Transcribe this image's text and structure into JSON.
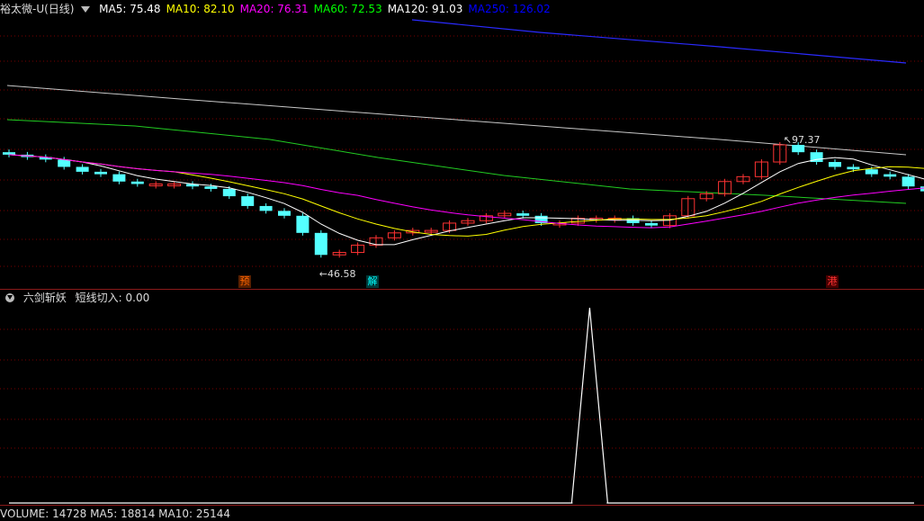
{
  "main_panel": {
    "stock_name": "裕太微-U(日线)",
    "indicators": [
      {
        "label": "MA5: 75.48",
        "color": "#ffffff"
      },
      {
        "label": "MA10: 82.10",
        "color": "#ffff00"
      },
      {
        "label": "MA20: 76.31",
        "color": "#ff00ff"
      },
      {
        "label": "MA60: 72.53",
        "color": "#00ff00"
      },
      {
        "label": "MA120: 91.03",
        "color": "#ffffff"
      },
      {
        "label": "MA250: 126.02",
        "color": "#0000ff"
      }
    ],
    "high_label": "97.37",
    "low_label": "46.58",
    "tags": [
      {
        "text": "预",
        "color": "#ff6600",
        "bg": "#5a2000"
      },
      {
        "text": "解",
        "color": "#00ffff",
        "bg": "#003a3a"
      },
      {
        "text": "港",
        "color": "#ff3333",
        "bg": "#4a0000"
      }
    ]
  },
  "sub_panel": {
    "title": "六剑斩妖",
    "value_label": "短线切入: 0.00"
  },
  "bottom_panel": {
    "label": "VOLUME: 14728  MA5: 18814  MA10: 25144"
  },
  "colors": {
    "up": "#ff3333",
    "down": "#54ffff",
    "grid": "#7a0000"
  },
  "chart_data": {
    "type": "candlestick",
    "close": [
      93,
      92,
      91,
      88,
      86,
      85,
      82,
      81,
      81,
      81,
      80,
      79,
      76,
      72,
      70,
      68,
      61,
      52,
      53,
      56,
      59,
      61,
      62,
      62,
      65,
      66,
      68,
      69,
      68,
      65,
      65,
      67,
      67,
      67,
      65,
      64,
      68,
      75,
      77,
      82,
      84,
      90,
      97,
      94,
      90,
      88,
      87,
      85,
      84,
      80,
      78,
      77,
      78,
      80
    ],
    "ma_values": {
      "MA5": 75.48,
      "MA10": 82.1,
      "MA20": 76.31,
      "MA60": 72.53,
      "MA120": 91.03,
      "MA250": 126.02
    },
    "high": 97.37,
    "low": 46.58,
    "signal": [
      0,
      0,
      0,
      0,
      0,
      0,
      0,
      0,
      0,
      0,
      0,
      0,
      0,
      0,
      0,
      0,
      0,
      0,
      0,
      0,
      0,
      0,
      0,
      0,
      0,
      0,
      0,
      0,
      0,
      0,
      0,
      0,
      0,
      0,
      1,
      0,
      0,
      0,
      0,
      0,
      0,
      0,
      0,
      0,
      0,
      0,
      0,
      0,
      0,
      0,
      0,
      0,
      0,
      0
    ]
  }
}
